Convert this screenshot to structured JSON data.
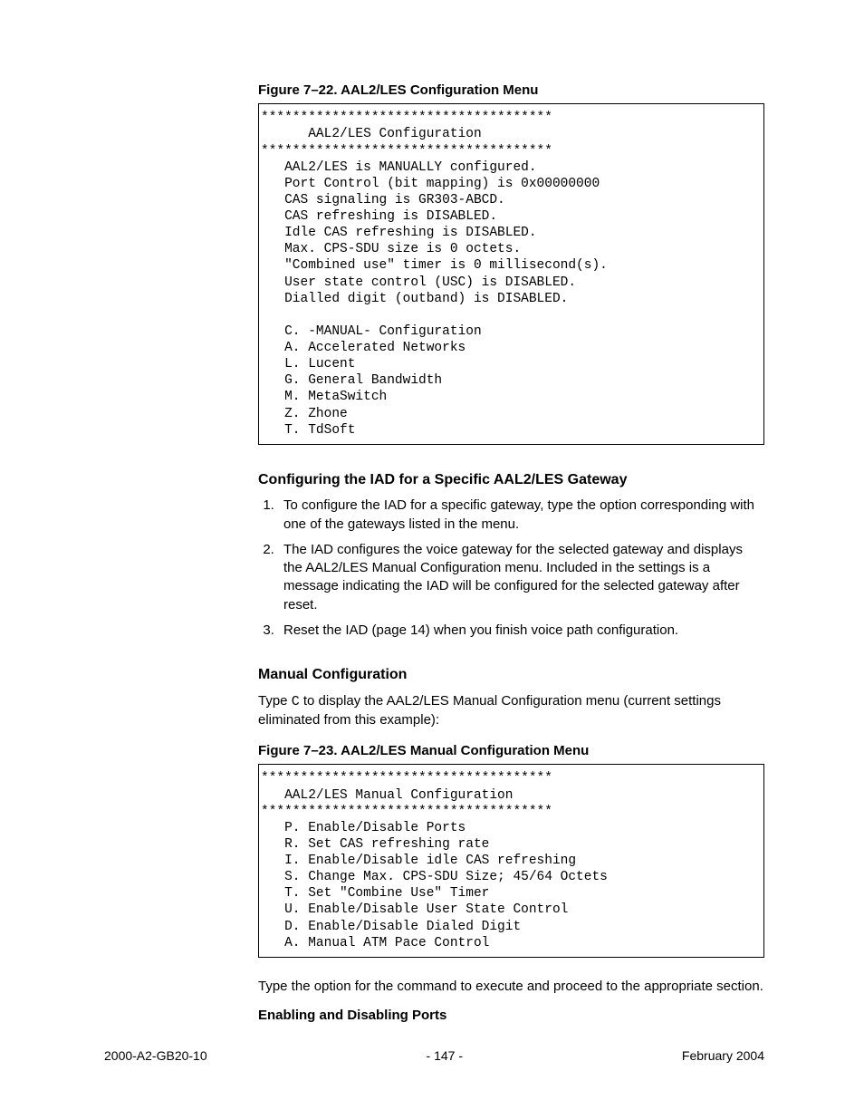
{
  "figure1": {
    "caption": "Figure 7–22.  AAL2/LES Configuration Menu",
    "content": "*************************************\n      AAL2/LES Configuration\n*************************************\n   AAL2/LES is MANUALLY configured.\n   Port Control (bit mapping) is 0x00000000\n   CAS signaling is GR303-ABCD.\n   CAS refreshing is DISABLED.\n   Idle CAS refreshing is DISABLED.\n   Max. CPS-SDU size is 0 octets.\n   \"Combined use\" timer is 0 millisecond(s).\n   User state control (USC) is DISABLED.\n   Dialled digit (outband) is DISABLED.\n\n   C. -MANUAL- Configuration\n   A. Accelerated Networks\n   L. Lucent\n   G. General Bandwidth\n   M. MetaSwitch\n   Z. Zhone\n   T. TdSoft"
  },
  "section1": {
    "heading": "Configuring the IAD for a Specific AAL2/LES Gateway",
    "steps": [
      "To configure the IAD for a specific gateway, type the option corresponding with one of the gateways listed in the menu.",
      "The IAD configures the voice gateway for the selected gateway and displays the AAL2/LES Manual Configuration menu. Included in the settings is a message indicating the IAD will be configured for the selected gateway after reset.",
      "Reset the IAD (page 14) when you finish voice path configuration."
    ]
  },
  "section2": {
    "heading": "Manual Configuration",
    "para_pre": "Type ",
    "para_key": "C",
    "para_post": " to display the AAL2/LES Manual Configuration menu (current settings eliminated from this example):"
  },
  "figure2": {
    "caption": "Figure 7–23.  AAL2/LES Manual Configuration Menu",
    "content": "*************************************\n   AAL2/LES Manual Configuration\n*************************************\n   P. Enable/Disable Ports\n   R. Set CAS refreshing rate\n   I. Enable/Disable idle CAS refreshing\n   S. Change Max. CPS-SDU Size; 45/64 Octets\n   T. Set \"Combine Use\" Timer\n   U. Enable/Disable User State Control\n   D. Enable/Disable Dialed Digit\n   A. Manual ATM Pace Control"
  },
  "closing_para": "Type the option for the command to execute and proceed to the appropriate section.",
  "subsection_title": "Enabling and Disabling Ports",
  "footer": {
    "left": "2000-A2-GB20-10",
    "center": "- 147 -",
    "right": "February 2004"
  }
}
